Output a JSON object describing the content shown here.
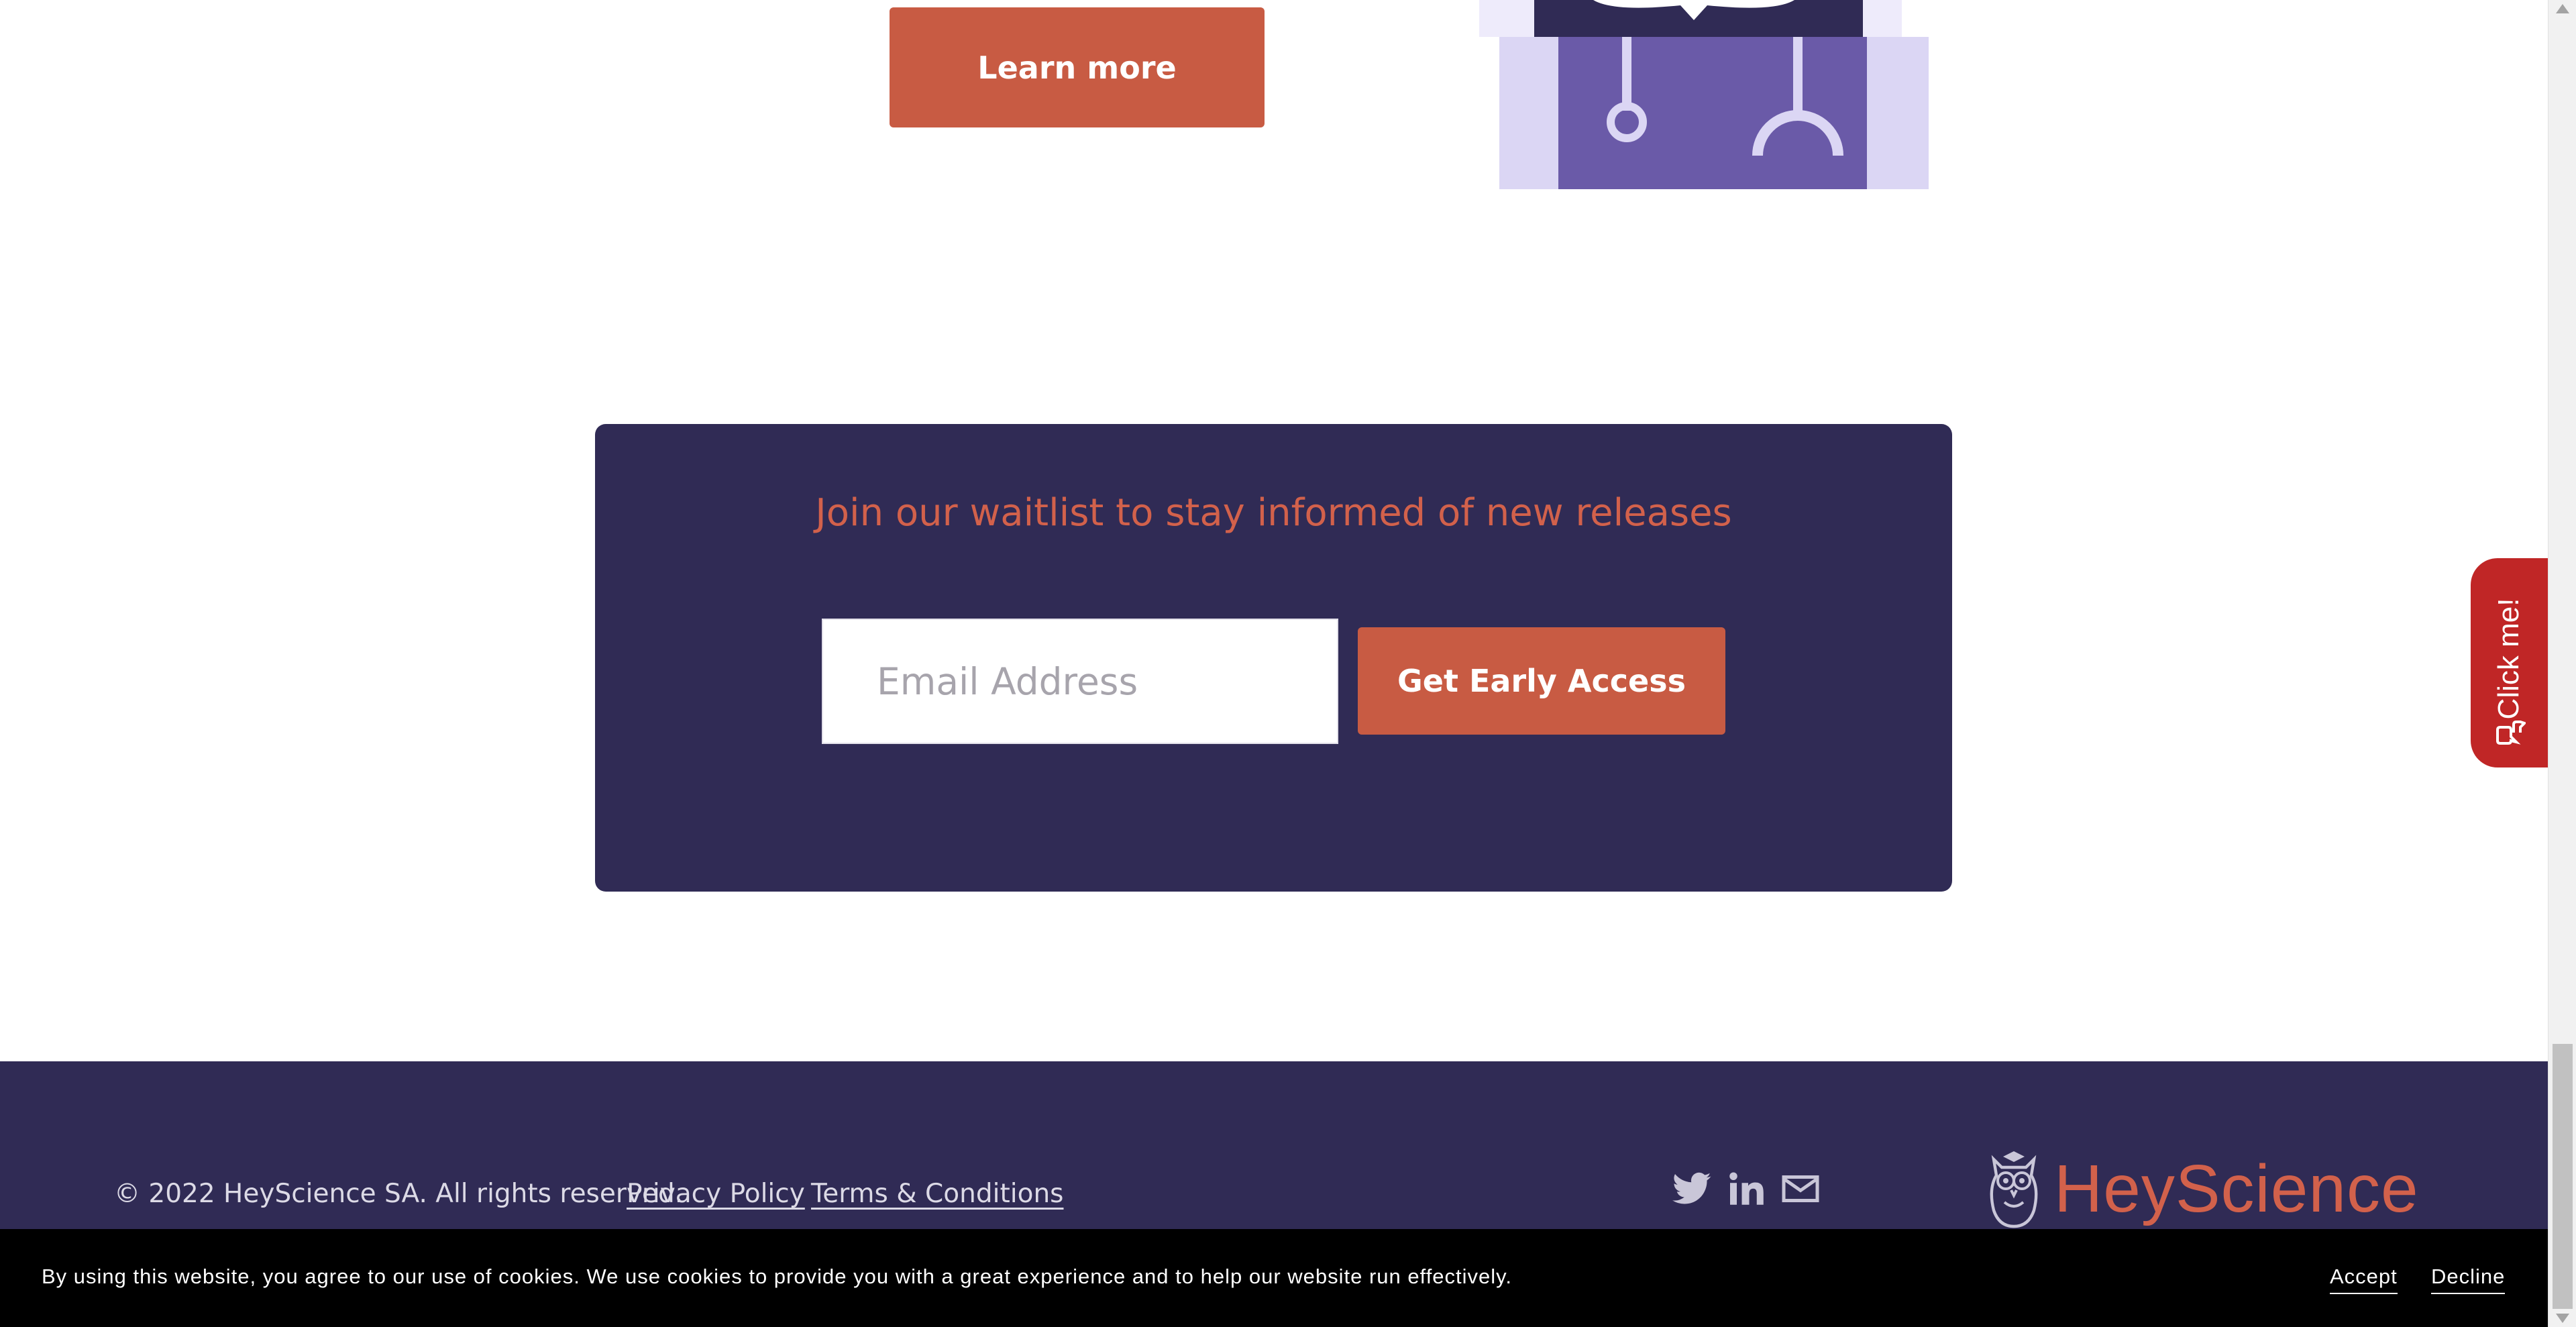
{
  "learn_more": {
    "label": "Learn more"
  },
  "waitlist": {
    "title": "Join our waitlist to stay informed of new releases",
    "email_placeholder": "Email Address",
    "email_value": "",
    "cta_label": "Get Early Access"
  },
  "footer": {
    "copyright": "© 2022 HeyScience SA. All rights reserved.",
    "links": {
      "privacy": "Privacy Policy",
      "terms": "Terms & Conditions"
    },
    "social_icons": [
      "twitter-icon",
      "linkedin-icon",
      "mail-icon"
    ],
    "logo_text": "HeyScience"
  },
  "cookie_bar": {
    "text": "By using this website, you agree to our use of cookies. We use cookies to provide you with a great experience and to help our website run effectively.",
    "accept_label": "Accept",
    "decline_label": "Decline"
  },
  "feedback_tab": {
    "label": "Click me!"
  },
  "colors": {
    "accent": "#c85b43",
    "navy": "#302b55",
    "title_orange": "#d2614b",
    "feedback_red": "#c02626",
    "illustration_purple": "#6a5aa8",
    "illustration_lavender": "#dbd6f4"
  }
}
